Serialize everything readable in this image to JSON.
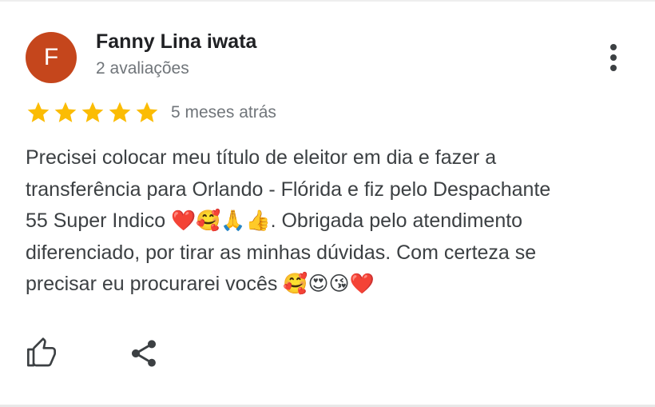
{
  "reviewer": {
    "initial": "F",
    "name": "Fanny Lina iwata",
    "review_count": "2 avaliações",
    "avatar_color": "#c5461c"
  },
  "rating": {
    "stars": 5,
    "max_stars": 5,
    "star_color": "#fbbc04",
    "time_ago": "5 meses atrás"
  },
  "review": {
    "text": "Precisei colocar meu título de eleitor em dia e fazer a\ntransferência para Orlando - Flórida e fiz pelo Despachante\n55 Super Indico ❤️🥰🙏👍. Obrigada pelo atendimento\ndiferenciado, por tirar as minhas dúvidas. Com certeza se\nprecisar eu procurarei vocês 🥰😍😘❤️"
  },
  "actions": {
    "more_icon": "more-vert-icon",
    "like_icon": "thumb-up-icon",
    "share_icon": "share-icon"
  }
}
